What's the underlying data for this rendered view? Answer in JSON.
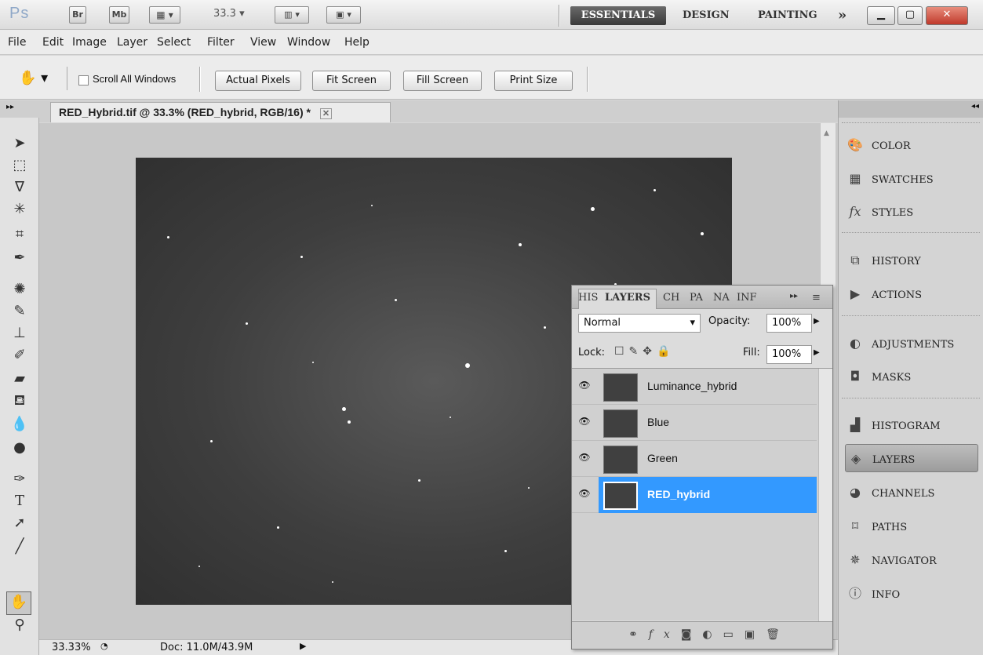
{
  "appbar": {
    "logo": "Ps",
    "br_label": "Br",
    "mb_label": "Mb",
    "zoom": "33.3",
    "workspaces": [
      "ESSENTIALS",
      "DESIGN",
      "PAINTING"
    ],
    "more_glyph": "»"
  },
  "menubar": {
    "items": [
      "File",
      "Edit",
      "Image",
      "Layer",
      "Select",
      "Filter",
      "View",
      "Window",
      "Help"
    ]
  },
  "options": {
    "scroll_all_windows": "Scroll All Windows",
    "buttons": [
      "Actual Pixels",
      "Fit Screen",
      "Fill Screen",
      "Print Size"
    ]
  },
  "document": {
    "tab_title": "RED_Hybrid.tif @ 33.3% (RED_hybrid, RGB/16) *"
  },
  "status": {
    "zoom": "33.33%",
    "doc": "Doc: 11.0M/43.9M"
  },
  "layers_panel": {
    "tabs": [
      "HIS",
      "LAYERS",
      "CH",
      "PA",
      "NA",
      "INF"
    ],
    "blend_mode": "Normal",
    "opacity_label": "Opacity:",
    "opacity": "100%",
    "lock_label": "Lock:",
    "fill_label": "Fill:",
    "fill": "100%",
    "layers": [
      {
        "name": "Luminance_hybrid",
        "selected": false
      },
      {
        "name": "Blue",
        "selected": false
      },
      {
        "name": "Green",
        "selected": false
      },
      {
        "name": "RED_hybrid",
        "selected": true
      }
    ]
  },
  "dock": {
    "groups": [
      [
        {
          "label": "COLOR",
          "icon": "color-icon"
        },
        {
          "label": "SWATCHES",
          "icon": "swatches-icon"
        },
        {
          "label": "STYLES",
          "icon": "styles-icon"
        }
      ],
      [
        {
          "label": "HISTORY",
          "icon": "history-icon"
        },
        {
          "label": "ACTIONS",
          "icon": "actions-icon"
        }
      ],
      [
        {
          "label": "ADJUSTMENTS",
          "icon": "adjustments-icon"
        },
        {
          "label": "MASKS",
          "icon": "masks-icon"
        }
      ],
      [
        {
          "label": "HISTOGRAM",
          "icon": "histogram-icon"
        },
        {
          "label": "LAYERS",
          "icon": "layers-icon"
        },
        {
          "label": "CHANNELS",
          "icon": "channels-icon"
        },
        {
          "label": "PATHS",
          "icon": "paths-icon"
        },
        {
          "label": "NAVIGATOR",
          "icon": "navigator-icon"
        },
        {
          "label": "INFO",
          "icon": "info-icon"
        }
      ]
    ]
  },
  "colors": {
    "selection": "#3399ff",
    "workspace_active": "#4a4a4a",
    "close_button": "#d9534f"
  }
}
